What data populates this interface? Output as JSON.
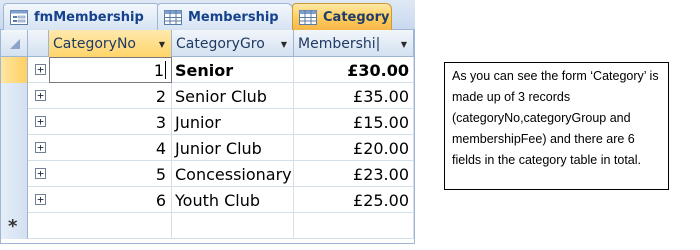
{
  "tabs": [
    {
      "label": "fmMembership",
      "icon": "form-icon",
      "active": false
    },
    {
      "label": "Membership",
      "icon": "table-icon",
      "active": false
    },
    {
      "label": "Category",
      "icon": "table-icon",
      "active": true
    }
  ],
  "columns": [
    {
      "label": "CategoryNo"
    },
    {
      "label": "CategoryGro"
    },
    {
      "label": "Membershi|"
    }
  ],
  "rows": [
    {
      "no": "1",
      "group": "Senior",
      "fee": "£30.00"
    },
    {
      "no": "2",
      "group": "Senior Club",
      "fee": "£35.00"
    },
    {
      "no": "3",
      "group": "Junior",
      "fee": "£15.00"
    },
    {
      "no": "4",
      "group": "Junior Club",
      "fee": "£20.00"
    },
    {
      "no": "5",
      "group": "Concessionary",
      "fee": "£23.00"
    },
    {
      "no": "6",
      "group": "Youth Club",
      "fee": "£25.00"
    }
  ],
  "new_record_marker": "*",
  "expander_symbol": "+",
  "note": "As you can see the form ‘Category’ is made up of 3 records (categoryNo,categoryGroup and membershipFee) and there are 6 fields in the category table in total.",
  "colors": {
    "active_tab": "#ffcc5a",
    "header_blue": "#d4e1f1",
    "border_blue": "#9eb6d4",
    "tab_text": "#15428b"
  }
}
